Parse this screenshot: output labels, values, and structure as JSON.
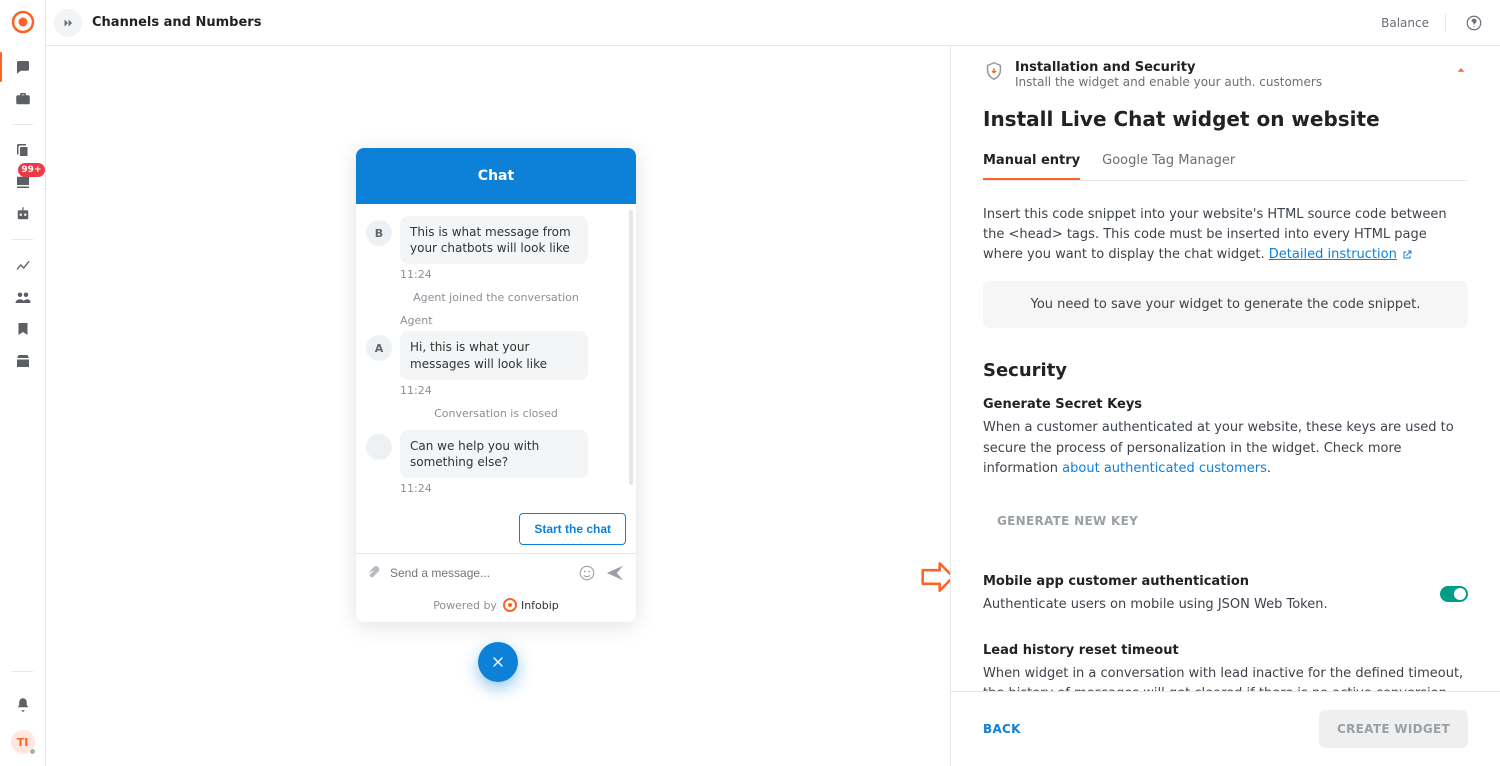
{
  "topbar": {
    "title": "Channels and Numbers",
    "balance_label": "Balance",
    "avatar_initials": "TI",
    "badge": "99+"
  },
  "chat": {
    "header": "Chat",
    "messages": {
      "bot_avatar": "B",
      "bot_text": "This is what message from your chatbots will look like",
      "bot_time": "11:24",
      "system_joined": "Agent joined the conversation",
      "agent_label": "Agent",
      "agent_avatar": "A",
      "agent_text": "Hi, this is what your messages will look like",
      "agent_time": "11:24",
      "system_closed": "Conversation is closed",
      "help_text": "Can we help you with something else?",
      "help_time": "11:24"
    },
    "start_btn": "Start the chat",
    "composer_placeholder": "Send a message...",
    "powered_by": "Powered by",
    "brand": "Infobip"
  },
  "panel": {
    "head_title": "Installation and Security",
    "head_sub": "Install the widget and enable your auth. customers",
    "install_title": "Install Live Chat widget on website",
    "tabs": {
      "manual": "Manual entry",
      "gtm": "Google Tag Manager"
    },
    "code_intro": "Insert this code snippet into your website's HTML source code between the <head> tags. This code must be inserted into every HTML page where you want to display the chat widget.",
    "detailed_link": "Detailed instruction",
    "save_note": "You need to save your widget to generate the code snippet.",
    "security_title": "Security",
    "keys_title": "Generate Secret Keys",
    "keys_desc": "When a customer authenticated at your website, these keys are used to secure the process of personalization in the widget. Check more information ",
    "keys_link": "about authenticated customers",
    "gen_key_btn": "GENERATE NEW KEY",
    "jwt_title": "Mobile app customer authentication",
    "jwt_desc": "Authenticate users on mobile using JSON Web Token.",
    "lead_title": "Lead history reset timeout",
    "lead_desc": "When widget in a conversation with lead inactive for the defined timeout, the history of messages will get cleared if there is no active conversion with the lead.",
    "footer_back": "BACK",
    "footer_create": "CREATE WIDGET"
  }
}
